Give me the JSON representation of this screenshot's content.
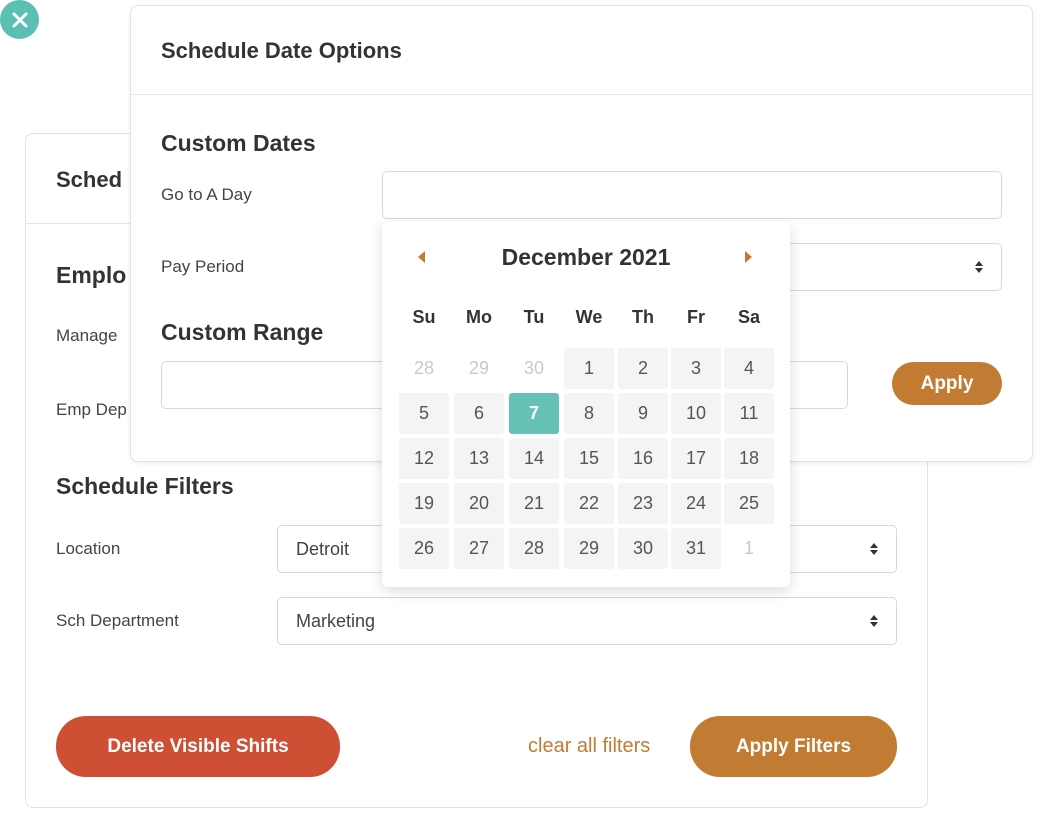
{
  "back_panel": {
    "title": "Sched",
    "section_employee": "Emplo",
    "label_manager": "Manage",
    "label_emp_dept": "Emp Dep",
    "section_filters": "Schedule Filters",
    "location_label": "Location",
    "location_value": "Detroit",
    "sch_dept_label": "Sch Department",
    "sch_dept_value": "Marketing",
    "delete_button": "Delete Visible Shifts",
    "clear_link": "clear all filters",
    "apply_filters_button": "Apply Filters"
  },
  "modal": {
    "title": "Schedule Date Options",
    "custom_dates": "Custom Dates",
    "go_to_day_label": "Go to A Day",
    "go_to_day_value": "",
    "pay_period_label": "Pay Period",
    "pay_period_value": "",
    "custom_range": "Custom Range",
    "range_start_value": "",
    "range_end_value": "",
    "apply_button": "Apply"
  },
  "calendar": {
    "month_label": "December 2021",
    "weekdays": [
      "Su",
      "Mo",
      "Tu",
      "We",
      "Th",
      "Fr",
      "Sa"
    ],
    "weeks": [
      [
        "28",
        "29",
        "30",
        "1",
        "2",
        "3",
        "4"
      ],
      [
        "5",
        "6",
        "7",
        "8",
        "9",
        "10",
        "11"
      ],
      [
        "12",
        "13",
        "14",
        "15",
        "16",
        "17",
        "18"
      ],
      [
        "19",
        "20",
        "21",
        "22",
        "23",
        "24",
        "25"
      ],
      [
        "26",
        "27",
        "28",
        "29",
        "30",
        "31",
        "1"
      ]
    ],
    "selected_day": "7"
  },
  "colors": {
    "accent_teal": "#5bbfb3",
    "accent_brown": "#c27b33",
    "danger_red": "#cf4f35"
  }
}
